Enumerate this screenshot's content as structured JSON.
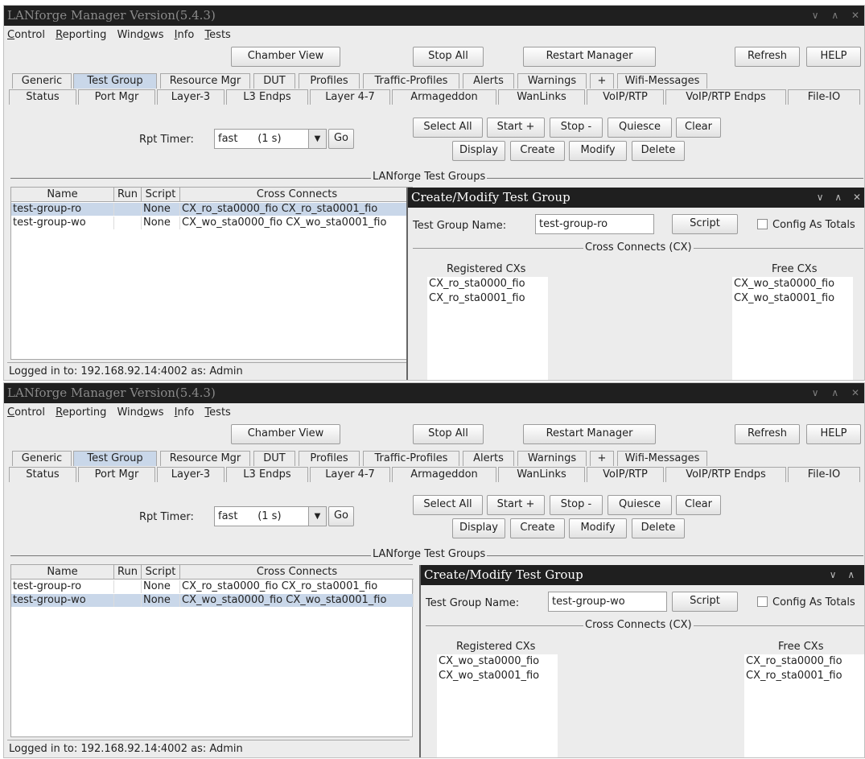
{
  "windows": [
    {
      "title": "LANforge Manager   Version(5.4.3)",
      "menu": [
        {
          "label": "Control",
          "underline": "C"
        },
        {
          "label": "Reporting",
          "underline": "R"
        },
        {
          "label": "Windows",
          "underline": ""
        },
        {
          "label": "Info",
          "underline": ""
        },
        {
          "label": "Tests",
          "underline": "T"
        }
      ],
      "toolbar": {
        "chamber_view": "Chamber View",
        "stop_all": "Stop All",
        "restart_manager": "Restart Manager",
        "refresh": "Refresh",
        "help": "HELP"
      },
      "tabs_row1": [
        "Generic",
        "Test Group",
        "Resource Mgr",
        "DUT",
        "Profiles",
        "Traffic-Profiles",
        "Alerts",
        "Warnings",
        "+",
        "Wifi-Messages"
      ],
      "tabs_row2": [
        "Status",
        "Port Mgr",
        "Layer-3",
        "L3 Endps",
        "Layer 4-7",
        "Armageddon",
        "WanLinks",
        "VoIP/RTP",
        "VoIP/RTP Endps",
        "File-IO"
      ],
      "active_tab": "Test Group",
      "rpt_timer": {
        "label": "Rpt Timer:",
        "value": "fast      (1 s)",
        "go": "Go"
      },
      "actions": {
        "select_all": "Select All",
        "start": "Start +",
        "stop": "Stop -",
        "quiesce": "Quiesce",
        "clear": "Clear",
        "display": "Display",
        "create": "Create",
        "modify": "Modify",
        "delete": "Delete"
      },
      "group_title": "LANforge Test Groups",
      "table": {
        "headers": [
          "Name",
          "Run",
          "Script",
          "Cross Connects"
        ],
        "rows": [
          {
            "name": "test-group-ro",
            "run": "",
            "script": "None",
            "cross_connects": "CX_ro_sta0000_fio CX_ro_sta0001_fio"
          },
          {
            "name": "test-group-wo",
            "run": "",
            "script": "None",
            "cross_connects": "CX_wo_sta0000_fio CX_wo_sta0001_fio"
          }
        ],
        "selected_row": 0
      },
      "status": "Logged in to:  192.168.92.14:4002  as:  Admin",
      "dialog": {
        "title": "Create/Modify Test Group",
        "name_label": "Test Group Name:",
        "name_value": "test-group-ro",
        "script_button": "Script",
        "config_totals": "Config As Totals",
        "cx_group": "Cross Connects (CX)",
        "registered_title": "Registered CXs",
        "registered": [
          "CX_ro_sta0000_fio",
          "CX_ro_sta0001_fio"
        ],
        "free_title": "Free CXs",
        "free": [
          "CX_wo_sta0000_fio",
          "CX_wo_sta0001_fio"
        ]
      }
    },
    {
      "title": "LANforge Manager   Version(5.4.3)",
      "menu": [
        {
          "label": "Control",
          "underline": "C"
        },
        {
          "label": "Reporting",
          "underline": "R"
        },
        {
          "label": "Windows",
          "underline": ""
        },
        {
          "label": "Info",
          "underline": ""
        },
        {
          "label": "Tests",
          "underline": "T"
        }
      ],
      "toolbar": {
        "chamber_view": "Chamber View",
        "stop_all": "Stop All",
        "restart_manager": "Restart Manager",
        "refresh": "Refresh",
        "help": "HELP"
      },
      "tabs_row1": [
        "Generic",
        "Test Group",
        "Resource Mgr",
        "DUT",
        "Profiles",
        "Traffic-Profiles",
        "Alerts",
        "Warnings",
        "+",
        "Wifi-Messages"
      ],
      "tabs_row2": [
        "Status",
        "Port Mgr",
        "Layer-3",
        "L3 Endps",
        "Layer 4-7",
        "Armageddon",
        "WanLinks",
        "VoIP/RTP",
        "VoIP/RTP Endps",
        "File-IO"
      ],
      "active_tab": "Test Group",
      "rpt_timer": {
        "label": "Rpt Timer:",
        "value": "fast      (1 s)",
        "go": "Go"
      },
      "actions": {
        "select_all": "Select All",
        "start": "Start +",
        "stop": "Stop -",
        "quiesce": "Quiesce",
        "clear": "Clear",
        "display": "Display",
        "create": "Create",
        "modify": "Modify",
        "delete": "Delete"
      },
      "group_title": "LANforge Test Groups",
      "table": {
        "headers": [
          "Name",
          "Run",
          "Script",
          "Cross Connects"
        ],
        "rows": [
          {
            "name": "test-group-ro",
            "run": "",
            "script": "None",
            "cross_connects": "CX_ro_sta0000_fio CX_ro_sta0001_fio"
          },
          {
            "name": "test-group-wo",
            "run": "",
            "script": "None",
            "cross_connects": "CX_wo_sta0000_fio CX_wo_sta0001_fio"
          }
        ],
        "selected_row": 1
      },
      "status": "Logged in to:  192.168.92.14:4002  as:  Admin",
      "dialog": {
        "title": "Create/Modify Test Group",
        "name_label": "Test Group Name:",
        "name_value": "test-group-wo",
        "script_button": "Script",
        "config_totals": "Config As Totals",
        "cx_group": "Cross Connects (CX)",
        "registered_title": "Registered CXs",
        "registered": [
          "CX_wo_sta0000_fio",
          "CX_wo_sta0001_fio"
        ],
        "free_title": "Free CXs",
        "free": [
          "CX_ro_sta0000_fio",
          "CX_ro_sta0001_fio"
        ]
      }
    }
  ],
  "colors": {
    "titlebar_bg": "#1f1f1f",
    "selection_bg": "#c9d7e9",
    "panel_bg": "#ececec"
  }
}
